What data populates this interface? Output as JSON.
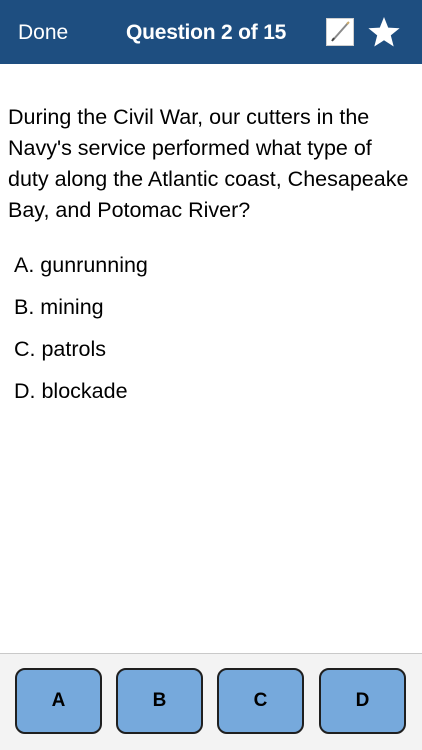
{
  "navbar": {
    "done_label": "Done",
    "title": "Question 2 of 15",
    "note_icon": "pencil-note-icon",
    "star_icon": "star-icon",
    "color": "#1e4e80"
  },
  "question": {
    "text": "During the Civil War, our cutters in the Navy's service performed what type of duty along the Atlantic coast, Chesapeake Bay, and Potomac River?"
  },
  "answers": [
    {
      "label": "A. gunrunning"
    },
    {
      "label": "B. mining"
    },
    {
      "label": "C. patrols"
    },
    {
      "label": "D. blockade"
    }
  ],
  "choice_buttons": [
    {
      "label": "A"
    },
    {
      "label": "B"
    },
    {
      "label": "C"
    },
    {
      "label": "D"
    }
  ],
  "colors": {
    "button_fill": "#76a9dc",
    "button_border": "#1f1f1f",
    "bottom_bar": "#f3f3f3"
  }
}
